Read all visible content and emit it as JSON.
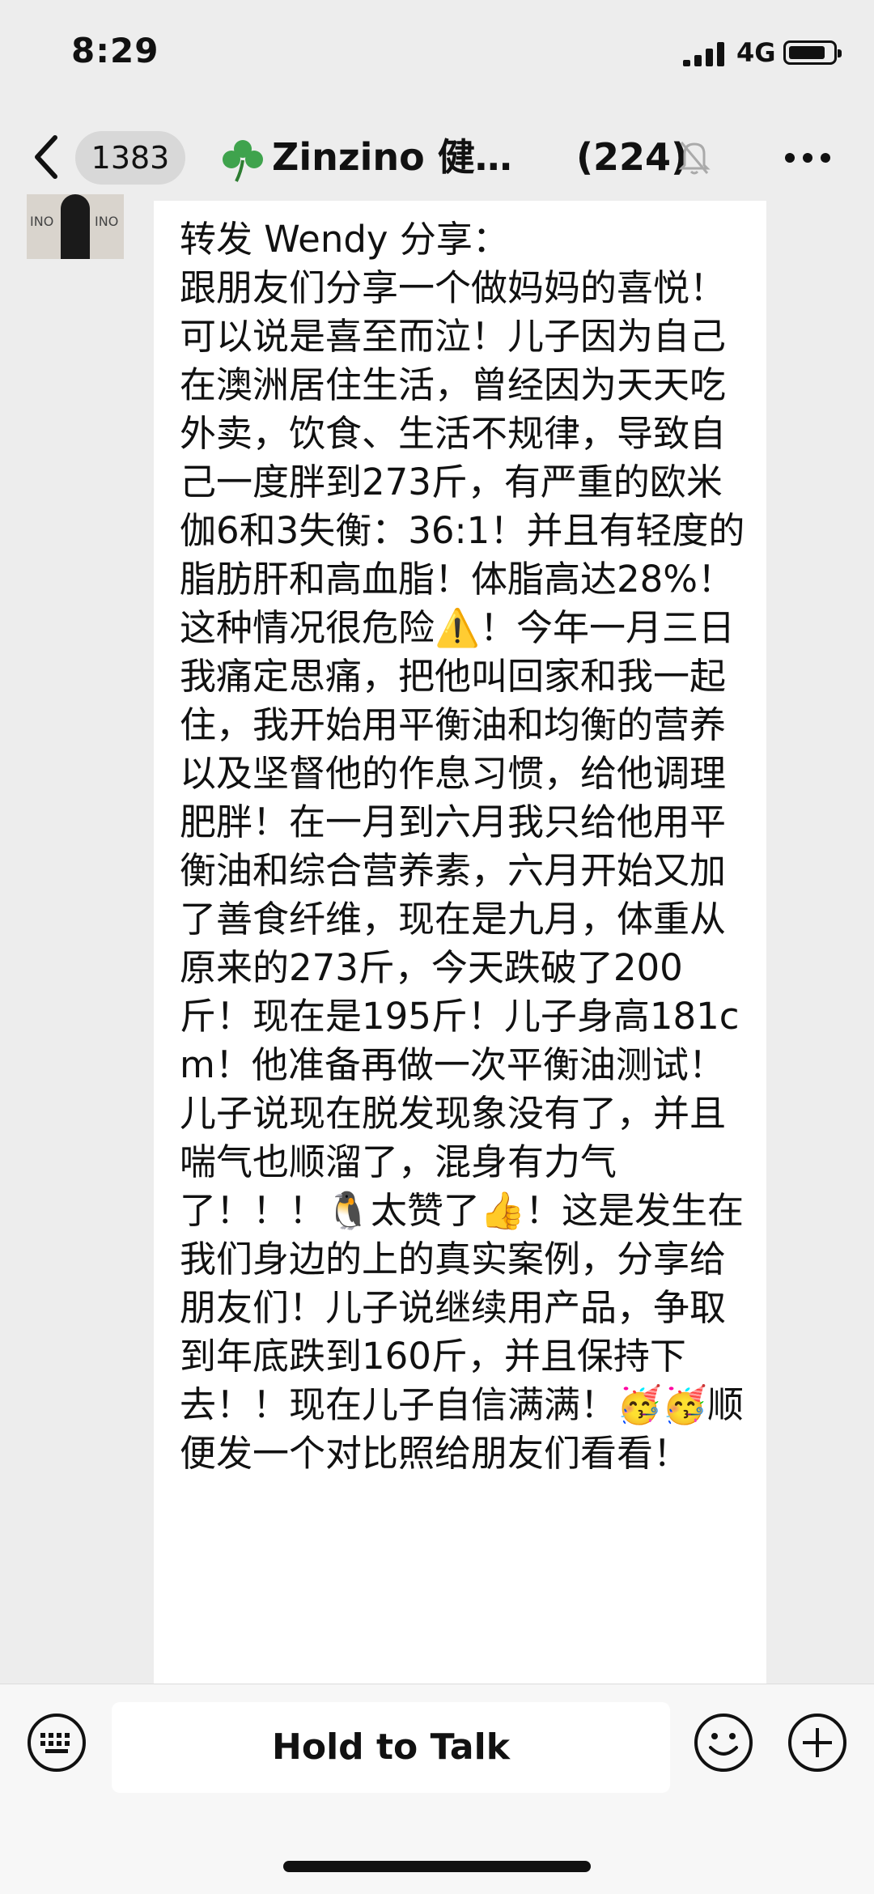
{
  "status_bar": {
    "time": "8:29",
    "network": "4G"
  },
  "nav": {
    "unread_badge": "1383",
    "title": "Zinzino 健康…",
    "member_count": "(224)"
  },
  "message": {
    "text": "转发 Wendy 分享：\n跟朋友们分享一个做妈妈的喜悦！可以说是喜至而泣！儿子因为自己在澳洲居住生活，曾经因为天天吃外卖，饮食、生活不规律，导致自己一度胖到273斤，有严重的欧米伽6和3失衡：36:1！并且有轻度的脂肪肝和高血脂！体脂高达28%！这种情况很危险⚠️！今年一月三日我痛定思痛，把他叫回家和我一起住，我开始用平衡油和均衡的营养以及坚督他的作息习惯，给他调理肥胖！在一月到六月我只给他用平衡油和综合营养素，六月开始又加了善食纤维，现在是九月，体重从原来的273斤，今天跌破了200斤！现在是195斤！儿子身高181cm！他准备再做一次平衡油测试！儿子说现在脱发现象没有了，并且喘气也顺溜了，混身有力气了！！！🐧太赞了👍！这是发生在我们身边的上的真实案例，分享给朋友们！儿子说继续用产品，争取到年底跌到160斤，并且保持下去！！现在儿子自信满满！🥳🥳顺便发一个对比照给朋友们看看！"
  },
  "avatar_text": "INO",
  "input_bar": {
    "hold_to_talk": "Hold to Talk"
  },
  "icons": {
    "back": "chevron-left-icon",
    "group": "clover-icon",
    "mute": "bell-muted-icon",
    "more": "more-dots-icon",
    "keyboard": "keyboard-icon",
    "emoji": "emoji-icon",
    "plus": "plus-circle-icon"
  }
}
